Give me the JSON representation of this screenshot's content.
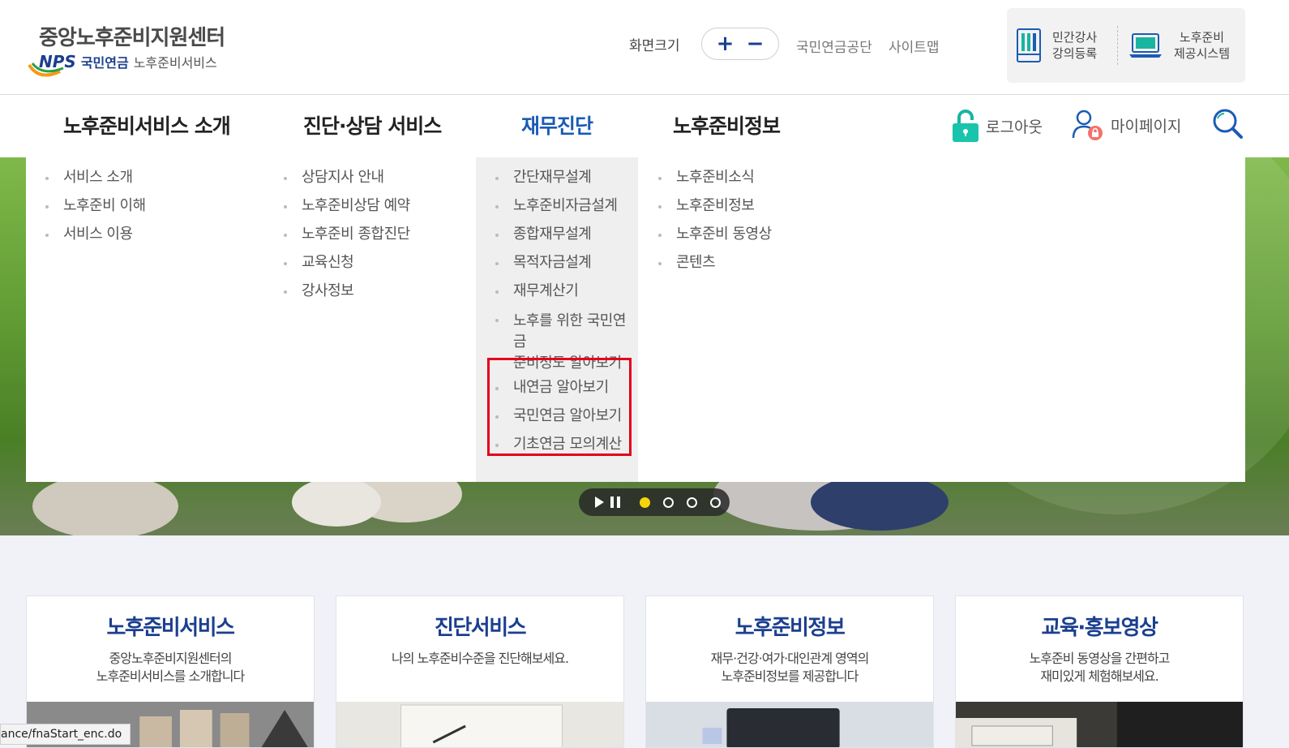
{
  "header": {
    "logo_title": "중앙노후준비지원센터",
    "logo_nps": "NPS",
    "logo_nps_kr": "국민연금",
    "logo_service": "노후준비서비스",
    "fontsize_label": "화면크기",
    "fontsize_plus": "+",
    "fontsize_minus": "−",
    "links": [
      "국민연금공단",
      "사이트맵"
    ],
    "quick": [
      {
        "line1": "민간강사",
        "line2": "강의등록",
        "icon": "bookshelf-icon"
      },
      {
        "line1": "노후준비",
        "line2": "제공시스템",
        "icon": "laptop-icon"
      }
    ]
  },
  "gnb": {
    "items": [
      "노후준비서비스 소개",
      "진단·상담 서비스",
      "재무진단",
      "노후준비정보"
    ],
    "active_index": 2,
    "logout": "로그아웃",
    "mypage": "마이페이지",
    "colors": {
      "active": "#1b5bb5",
      "accent": "#1b3f8f",
      "highlight": "#e4001b"
    }
  },
  "mega": {
    "col1": [
      "서비스 소개",
      "노후준비 이해",
      "서비스 이용"
    ],
    "col2": [
      "상담지사 안내",
      "노후준비상담 예약",
      "노후준비 종합진단",
      "교육신청",
      "강사정보"
    ],
    "col3": [
      "간단재무설계",
      "노후준비자금설계",
      "종합재무설계",
      "목적자금설계",
      "재무계산기",
      "노후를 위한 국민연금",
      "준비정도 알아보기",
      "내연금 알아보기",
      "국민연금 알아보기",
      "기초연금 모의계산"
    ],
    "col4": [
      "노후준비소식",
      "노후준비정보",
      "노후준비 동영상",
      "콘텐츠"
    ]
  },
  "slider": {
    "dot_count": 4,
    "active_dot": 0
  },
  "cards": [
    {
      "title": "노후준비서비스",
      "desc1": "중앙노후준비지원센터의",
      "desc2": "노후준비서비스를 소개합니다"
    },
    {
      "title": "진단서비스",
      "desc1": "나의 노후준비수준을 진단해보세요.",
      "desc2": ""
    },
    {
      "title": "노후준비정보",
      "desc1": "재무·건강·여가·대인관계 영역의",
      "desc2": "노후준비정보를 제공합니다"
    },
    {
      "title": "교육·홍보영상",
      "desc1": "노후준비 동영상을 간편하고",
      "desc2": "재미있게 체험해보세요."
    }
  ],
  "status_bar": "ance/fnaStart_enc.do"
}
